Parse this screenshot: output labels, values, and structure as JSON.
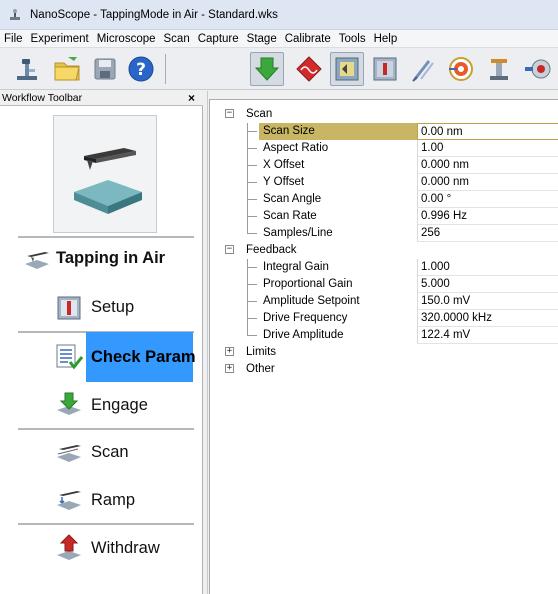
{
  "window": {
    "title": "NanoScope - TappingMode in Air - Standard.wks"
  },
  "menu": [
    "File",
    "Experiment",
    "Microscope",
    "Scan",
    "Capture",
    "Stage",
    "Calibrate",
    "Tools",
    "Help"
  ],
  "toolbar": {
    "buttons": [
      {
        "name": "microscope-icon"
      },
      {
        "name": "open-folder-icon"
      },
      {
        "name": "save-icon"
      },
      {
        "name": "help-icon"
      },
      {
        "name": "engage-arrow-icon"
      },
      {
        "name": "tune-icon"
      },
      {
        "name": "view-icon"
      },
      {
        "name": "setup-icon"
      },
      {
        "name": "probe-icon"
      },
      {
        "name": "target-icon"
      },
      {
        "name": "stage-icon"
      },
      {
        "name": "motor-icon"
      }
    ]
  },
  "workflow": {
    "header": "Workflow Toolbar",
    "close": "×",
    "items": [
      {
        "label": "Tapping in Air"
      },
      {
        "label": "Setup"
      },
      {
        "label": "Check Param"
      },
      {
        "label": "Engage"
      },
      {
        "label": "Scan"
      },
      {
        "label": "Ramp"
      },
      {
        "label": "Withdraw"
      }
    ]
  },
  "params": {
    "scan": {
      "label": "Scan",
      "expander": "⊟",
      "rows": [
        {
          "name": "Scan Size",
          "value": "0.00 nm"
        },
        {
          "name": "Aspect Ratio",
          "value": "1.00"
        },
        {
          "name": "X Offset",
          "value": "0.000 nm"
        },
        {
          "name": "Y Offset",
          "value": "0.000 nm"
        },
        {
          "name": "Scan Angle",
          "value": "0.00 °"
        },
        {
          "name": "Scan Rate",
          "value": "0.996 Hz"
        },
        {
          "name": "Samples/Line",
          "value": "256"
        }
      ]
    },
    "feedback": {
      "label": "Feedback",
      "expander": "⊟",
      "rows": [
        {
          "name": "Integral Gain",
          "value": "1.000"
        },
        {
          "name": "Proportional Gain",
          "value": "5.000"
        },
        {
          "name": "Amplitude Setpoint",
          "value": "150.0 mV"
        },
        {
          "name": "Drive Frequency",
          "value": "320.0000 kHz"
        },
        {
          "name": "Drive Amplitude",
          "value": "122.4 mV"
        }
      ]
    },
    "limits": {
      "label": "Limits",
      "expander": "⊞"
    },
    "other": {
      "label": "Other",
      "expander": "⊞"
    }
  },
  "colors": {
    "selection": "#c8b664",
    "active_step": "#3399ff"
  }
}
